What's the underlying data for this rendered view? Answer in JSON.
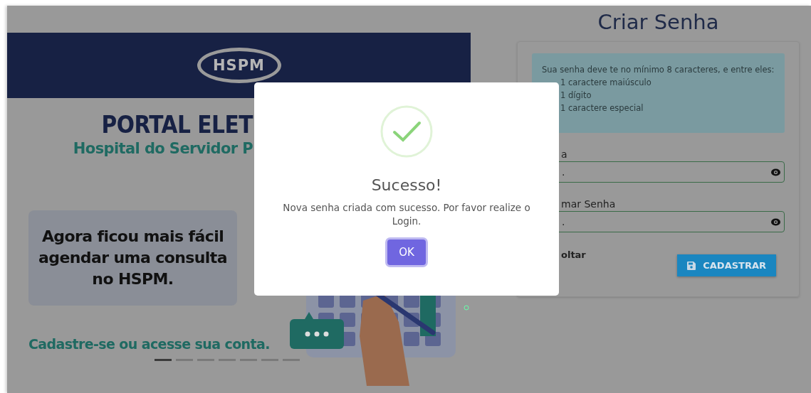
{
  "left_panel": {
    "logo": "HSPM",
    "title": "PORTAL ELET",
    "subtitle": "Hospital do Servidor P",
    "promo": "Agora ficou mais fácil agendar uma consulta no HSPM.",
    "cta": "Cadastre-se ou acesse sua conta.",
    "carousel": [
      {
        "selected": true
      },
      {
        "selected": false
      },
      {
        "selected": false
      },
      {
        "selected": false
      },
      {
        "selected": false
      },
      {
        "selected": false
      },
      {
        "selected": false
      }
    ]
  },
  "form": {
    "title": "Criar Senha",
    "rules_intro": "Sua senha deve te no mínimo 8 caracteres, e entre eles:",
    "rules": [
      "1 caractere maiúsculo",
      "1 dígito",
      "1 caractere especial"
    ],
    "fields": [
      {
        "label": "a",
        "value": "."
      },
      {
        "label": "mar Senha",
        "value": "."
      }
    ],
    "back_link": "oltar",
    "submit": "CADASTRAR"
  },
  "dialog": {
    "title": "Sucesso!",
    "message": "Nova senha criada com sucesso. Por favor realize o Login.",
    "button": "OK"
  }
}
